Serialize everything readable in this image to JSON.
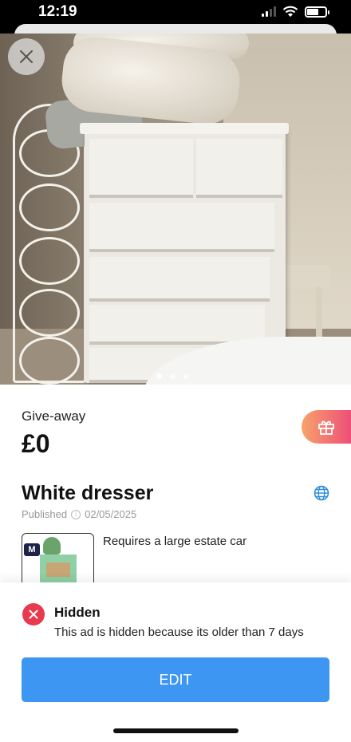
{
  "status_bar": {
    "time": "12:19"
  },
  "listing": {
    "price_type": "Give-away",
    "price": "£0",
    "title": "White dresser",
    "published_label": "Published",
    "published_date": "02/05/2025",
    "description": "Requires a large estate car",
    "thumb_badge": "M",
    "photo_pages": 3,
    "current_photo": 1
  },
  "banner": {
    "title": "Hidden",
    "text": "This ad is hidden because its older than 7 days",
    "edit_label": "EDIT"
  },
  "icons": {
    "close": "close-icon",
    "gift": "gift-icon",
    "globe": "globe-icon",
    "hidden": "close-circle-icon"
  },
  "colors": {
    "accent_blue": "#3c96f2",
    "hidden_red": "#e83a4f",
    "gift_gradient_start": "#f6a36c",
    "gift_gradient_end": "#ee4f77"
  }
}
